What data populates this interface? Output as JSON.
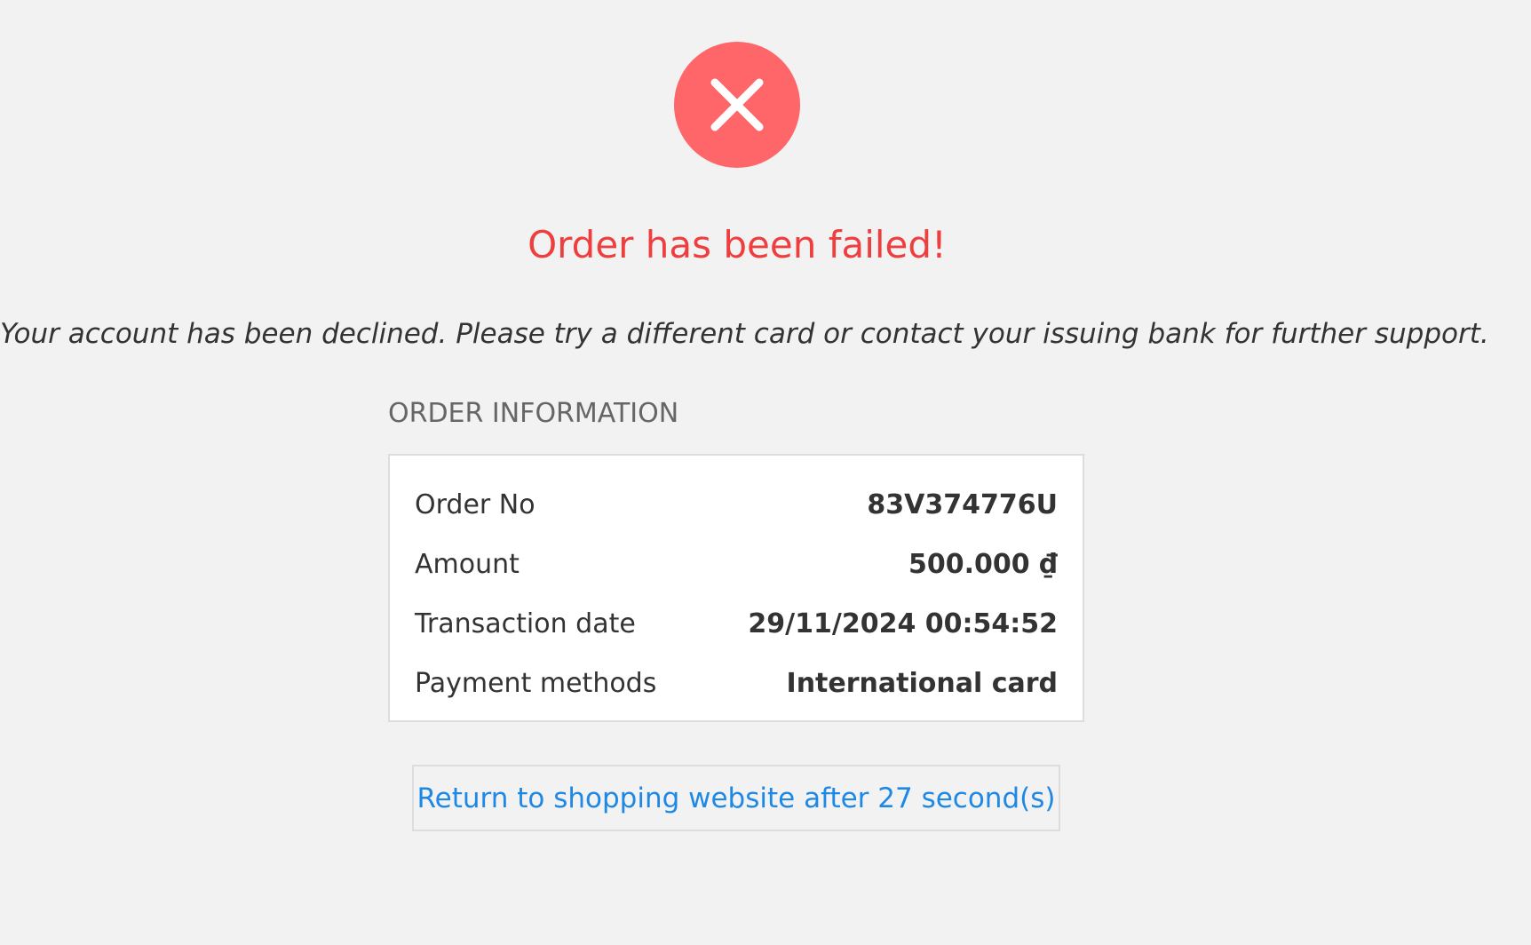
{
  "status": {
    "icon": "close-x-icon",
    "icon_color": "#ff6669",
    "title": "Order has been failed!",
    "title_color": "#ef3e3e",
    "message": "Your account has been declined. Please try a different card or contact your issuing bank for further support."
  },
  "order_info": {
    "heading": "ORDER INFORMATION",
    "rows": [
      {
        "label": "Order No",
        "value": "83V374776U"
      },
      {
        "label": "Amount",
        "value": "500.000 ₫"
      },
      {
        "label": "Transaction date",
        "value": "29/11/2024 00:54:52"
      },
      {
        "label": "Payment methods",
        "value": "International card"
      }
    ]
  },
  "return_button": {
    "label": "Return to shopping website after 27 second(s)",
    "color": "#1e88e5"
  }
}
